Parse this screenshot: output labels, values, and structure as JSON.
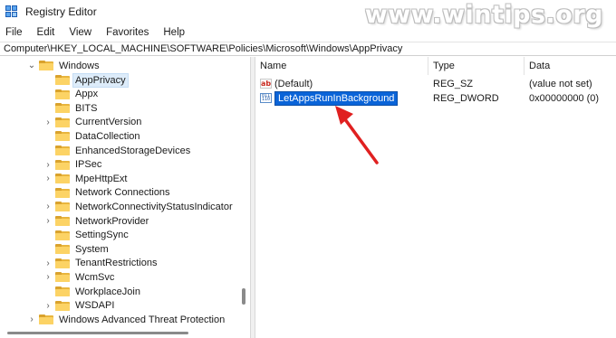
{
  "window": {
    "title": "Registry Editor"
  },
  "watermark": "www.wintips.org",
  "menu": [
    "File",
    "Edit",
    "View",
    "Favorites",
    "Help"
  ],
  "address": "Computer\\HKEY_LOCAL_MACHINE\\SOFTWARE\\Policies\\Microsoft\\Windows\\AppPrivacy",
  "tree": {
    "parent": "Windows",
    "children": [
      {
        "label": "AppPrivacy",
        "selected": true,
        "expandable": false
      },
      {
        "label": "Appx",
        "expandable": false
      },
      {
        "label": "BITS",
        "expandable": false
      },
      {
        "label": "CurrentVersion",
        "expandable": true
      },
      {
        "label": "DataCollection",
        "expandable": false
      },
      {
        "label": "EnhancedStorageDevices",
        "expandable": false
      },
      {
        "label": "IPSec",
        "expandable": true
      },
      {
        "label": "MpeHttpExt",
        "expandable": true
      },
      {
        "label": "Network Connections",
        "expandable": false
      },
      {
        "label": "NetworkConnectivityStatusIndicator",
        "expandable": true
      },
      {
        "label": "NetworkProvider",
        "expandable": true
      },
      {
        "label": "SettingSync",
        "expandable": false
      },
      {
        "label": "System",
        "expandable": false
      },
      {
        "label": "TenantRestrictions",
        "expandable": true
      },
      {
        "label": "WcmSvc",
        "expandable": true
      },
      {
        "label": "WorkplaceJoin",
        "expandable": false
      },
      {
        "label": "WSDAPI",
        "expandable": true
      }
    ],
    "sibling": "Windows Advanced Threat Protection"
  },
  "list": {
    "columns": [
      "Name",
      "Type",
      "Data"
    ],
    "rows": [
      {
        "name": "(Default)",
        "type": "REG_SZ",
        "data": "(value not set)",
        "icon": "string-value-icon"
      },
      {
        "name": "LetAppsRunInBackground",
        "type": "REG_DWORD",
        "data": "0x00000000 (0)",
        "icon": "dword-value-icon",
        "editing": true
      }
    ]
  },
  "colors": {
    "selection": "#0a64d8",
    "arrow": "#e02020",
    "folder": "#fcd365"
  }
}
